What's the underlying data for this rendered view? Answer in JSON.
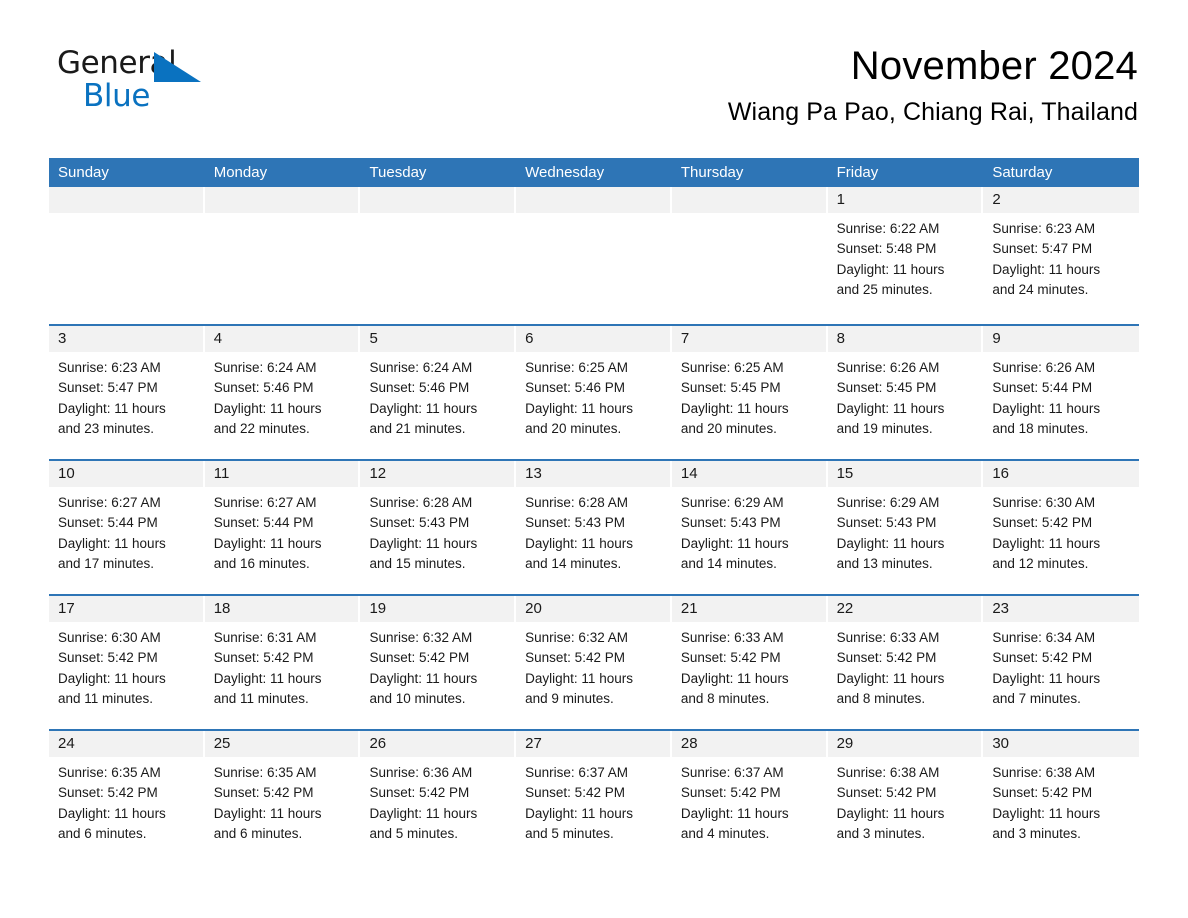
{
  "logo": {
    "word_general": "General",
    "word_blue": "Blue",
    "triangle_color": "#0a72c0",
    "icon": "general-blue-logo"
  },
  "header": {
    "month_title": "November 2024",
    "location": "Wiang Pa Pao, Chiang Rai, Thailand"
  },
  "colors": {
    "header_blue": "#2e75b6",
    "daynum_strip": "#f2f2f2",
    "text": "#1a1a1a",
    "logo_blue": "#0a72c0"
  },
  "weekdays": [
    "Sunday",
    "Monday",
    "Tuesday",
    "Wednesday",
    "Thursday",
    "Friday",
    "Saturday"
  ],
  "weeks": [
    [
      {
        "day": "",
        "sunrise": "",
        "sunset": "",
        "daylight": "",
        "daylight2": ""
      },
      {
        "day": "",
        "sunrise": "",
        "sunset": "",
        "daylight": "",
        "daylight2": ""
      },
      {
        "day": "",
        "sunrise": "",
        "sunset": "",
        "daylight": "",
        "daylight2": ""
      },
      {
        "day": "",
        "sunrise": "",
        "sunset": "",
        "daylight": "",
        "daylight2": ""
      },
      {
        "day": "",
        "sunrise": "",
        "sunset": "",
        "daylight": "",
        "daylight2": ""
      },
      {
        "day": "1",
        "sunrise": "Sunrise: 6:22 AM",
        "sunset": "Sunset: 5:48 PM",
        "daylight": "Daylight: 11 hours",
        "daylight2": "and 25 minutes."
      },
      {
        "day": "2",
        "sunrise": "Sunrise: 6:23 AM",
        "sunset": "Sunset: 5:47 PM",
        "daylight": "Daylight: 11 hours",
        "daylight2": "and 24 minutes."
      }
    ],
    [
      {
        "day": "3",
        "sunrise": "Sunrise: 6:23 AM",
        "sunset": "Sunset: 5:47 PM",
        "daylight": "Daylight: 11 hours",
        "daylight2": "and 23 minutes."
      },
      {
        "day": "4",
        "sunrise": "Sunrise: 6:24 AM",
        "sunset": "Sunset: 5:46 PM",
        "daylight": "Daylight: 11 hours",
        "daylight2": "and 22 minutes."
      },
      {
        "day": "5",
        "sunrise": "Sunrise: 6:24 AM",
        "sunset": "Sunset: 5:46 PM",
        "daylight": "Daylight: 11 hours",
        "daylight2": "and 21 minutes."
      },
      {
        "day": "6",
        "sunrise": "Sunrise: 6:25 AM",
        "sunset": "Sunset: 5:46 PM",
        "daylight": "Daylight: 11 hours",
        "daylight2": "and 20 minutes."
      },
      {
        "day": "7",
        "sunrise": "Sunrise: 6:25 AM",
        "sunset": "Sunset: 5:45 PM",
        "daylight": "Daylight: 11 hours",
        "daylight2": "and 20 minutes."
      },
      {
        "day": "8",
        "sunrise": "Sunrise: 6:26 AM",
        "sunset": "Sunset: 5:45 PM",
        "daylight": "Daylight: 11 hours",
        "daylight2": "and 19 minutes."
      },
      {
        "day": "9",
        "sunrise": "Sunrise: 6:26 AM",
        "sunset": "Sunset: 5:44 PM",
        "daylight": "Daylight: 11 hours",
        "daylight2": "and 18 minutes."
      }
    ],
    [
      {
        "day": "10",
        "sunrise": "Sunrise: 6:27 AM",
        "sunset": "Sunset: 5:44 PM",
        "daylight": "Daylight: 11 hours",
        "daylight2": "and 17 minutes."
      },
      {
        "day": "11",
        "sunrise": "Sunrise: 6:27 AM",
        "sunset": "Sunset: 5:44 PM",
        "daylight": "Daylight: 11 hours",
        "daylight2": "and 16 minutes."
      },
      {
        "day": "12",
        "sunrise": "Sunrise: 6:28 AM",
        "sunset": "Sunset: 5:43 PM",
        "daylight": "Daylight: 11 hours",
        "daylight2": "and 15 minutes."
      },
      {
        "day": "13",
        "sunrise": "Sunrise: 6:28 AM",
        "sunset": "Sunset: 5:43 PM",
        "daylight": "Daylight: 11 hours",
        "daylight2": "and 14 minutes."
      },
      {
        "day": "14",
        "sunrise": "Sunrise: 6:29 AM",
        "sunset": "Sunset: 5:43 PM",
        "daylight": "Daylight: 11 hours",
        "daylight2": "and 14 minutes."
      },
      {
        "day": "15",
        "sunrise": "Sunrise: 6:29 AM",
        "sunset": "Sunset: 5:43 PM",
        "daylight": "Daylight: 11 hours",
        "daylight2": "and 13 minutes."
      },
      {
        "day": "16",
        "sunrise": "Sunrise: 6:30 AM",
        "sunset": "Sunset: 5:42 PM",
        "daylight": "Daylight: 11 hours",
        "daylight2": "and 12 minutes."
      }
    ],
    [
      {
        "day": "17",
        "sunrise": "Sunrise: 6:30 AM",
        "sunset": "Sunset: 5:42 PM",
        "daylight": "Daylight: 11 hours",
        "daylight2": "and 11 minutes."
      },
      {
        "day": "18",
        "sunrise": "Sunrise: 6:31 AM",
        "sunset": "Sunset: 5:42 PM",
        "daylight": "Daylight: 11 hours",
        "daylight2": "and 11 minutes."
      },
      {
        "day": "19",
        "sunrise": "Sunrise: 6:32 AM",
        "sunset": "Sunset: 5:42 PM",
        "daylight": "Daylight: 11 hours",
        "daylight2": "and 10 minutes."
      },
      {
        "day": "20",
        "sunrise": "Sunrise: 6:32 AM",
        "sunset": "Sunset: 5:42 PM",
        "daylight": "Daylight: 11 hours",
        "daylight2": "and 9 minutes."
      },
      {
        "day": "21",
        "sunrise": "Sunrise: 6:33 AM",
        "sunset": "Sunset: 5:42 PM",
        "daylight": "Daylight: 11 hours",
        "daylight2": "and 8 minutes."
      },
      {
        "day": "22",
        "sunrise": "Sunrise: 6:33 AM",
        "sunset": "Sunset: 5:42 PM",
        "daylight": "Daylight: 11 hours",
        "daylight2": "and 8 minutes."
      },
      {
        "day": "23",
        "sunrise": "Sunrise: 6:34 AM",
        "sunset": "Sunset: 5:42 PM",
        "daylight": "Daylight: 11 hours",
        "daylight2": "and 7 minutes."
      }
    ],
    [
      {
        "day": "24",
        "sunrise": "Sunrise: 6:35 AM",
        "sunset": "Sunset: 5:42 PM",
        "daylight": "Daylight: 11 hours",
        "daylight2": "and 6 minutes."
      },
      {
        "day": "25",
        "sunrise": "Sunrise: 6:35 AM",
        "sunset": "Sunset: 5:42 PM",
        "daylight": "Daylight: 11 hours",
        "daylight2": "and 6 minutes."
      },
      {
        "day": "26",
        "sunrise": "Sunrise: 6:36 AM",
        "sunset": "Sunset: 5:42 PM",
        "daylight": "Daylight: 11 hours",
        "daylight2": "and 5 minutes."
      },
      {
        "day": "27",
        "sunrise": "Sunrise: 6:37 AM",
        "sunset": "Sunset: 5:42 PM",
        "daylight": "Daylight: 11 hours",
        "daylight2": "and 5 minutes."
      },
      {
        "day": "28",
        "sunrise": "Sunrise: 6:37 AM",
        "sunset": "Sunset: 5:42 PM",
        "daylight": "Daylight: 11 hours",
        "daylight2": "and 4 minutes."
      },
      {
        "day": "29",
        "sunrise": "Sunrise: 6:38 AM",
        "sunset": "Sunset: 5:42 PM",
        "daylight": "Daylight: 11 hours",
        "daylight2": "and 3 minutes."
      },
      {
        "day": "30",
        "sunrise": "Sunrise: 6:38 AM",
        "sunset": "Sunset: 5:42 PM",
        "daylight": "Daylight: 11 hours",
        "daylight2": "and 3 minutes."
      }
    ]
  ]
}
